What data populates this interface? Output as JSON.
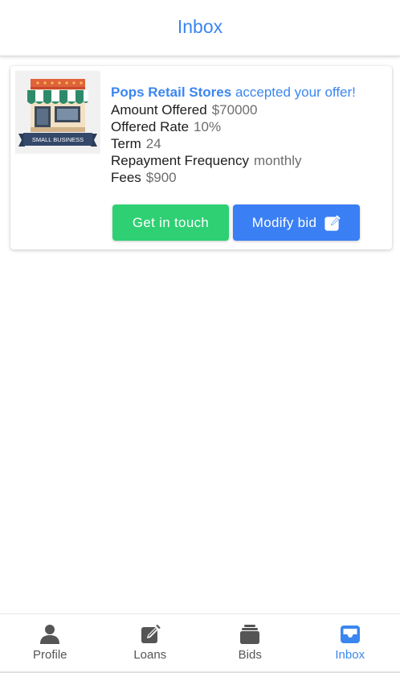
{
  "header": {
    "title": "Inbox"
  },
  "card": {
    "thumbnail": {
      "icon": "small-business-store-icon",
      "caption": "SMALL BUSINESS"
    },
    "company": "Pops Retail Stores",
    "message": " accepted your offer!",
    "details": [
      {
        "label": "Amount Offered",
        "value": "$70000"
      },
      {
        "label": "Offered Rate",
        "value": "10%"
      },
      {
        "label": "Term",
        "value": "24"
      },
      {
        "label": "Repayment Frequency",
        "value": "monthly"
      },
      {
        "label": "Fees",
        "value": "$900"
      }
    ],
    "buttons": {
      "get_in_touch": "Get in touch",
      "modify_bid": "Modify bid"
    }
  },
  "bottom_nav": {
    "items": [
      {
        "label": "Profile",
        "icon": "person-icon",
        "active": false
      },
      {
        "label": "Loans",
        "icon": "edit-note-icon",
        "active": false
      },
      {
        "label": "Bids",
        "icon": "stack-icon",
        "active": false
      },
      {
        "label": "Inbox",
        "icon": "inbox-tray-icon",
        "active": true
      }
    ]
  },
  "colors": {
    "accent": "#3b86f0",
    "success_button": "#2ed073",
    "primary_button": "#3b7ff5",
    "nav_inactive": "#555555"
  }
}
